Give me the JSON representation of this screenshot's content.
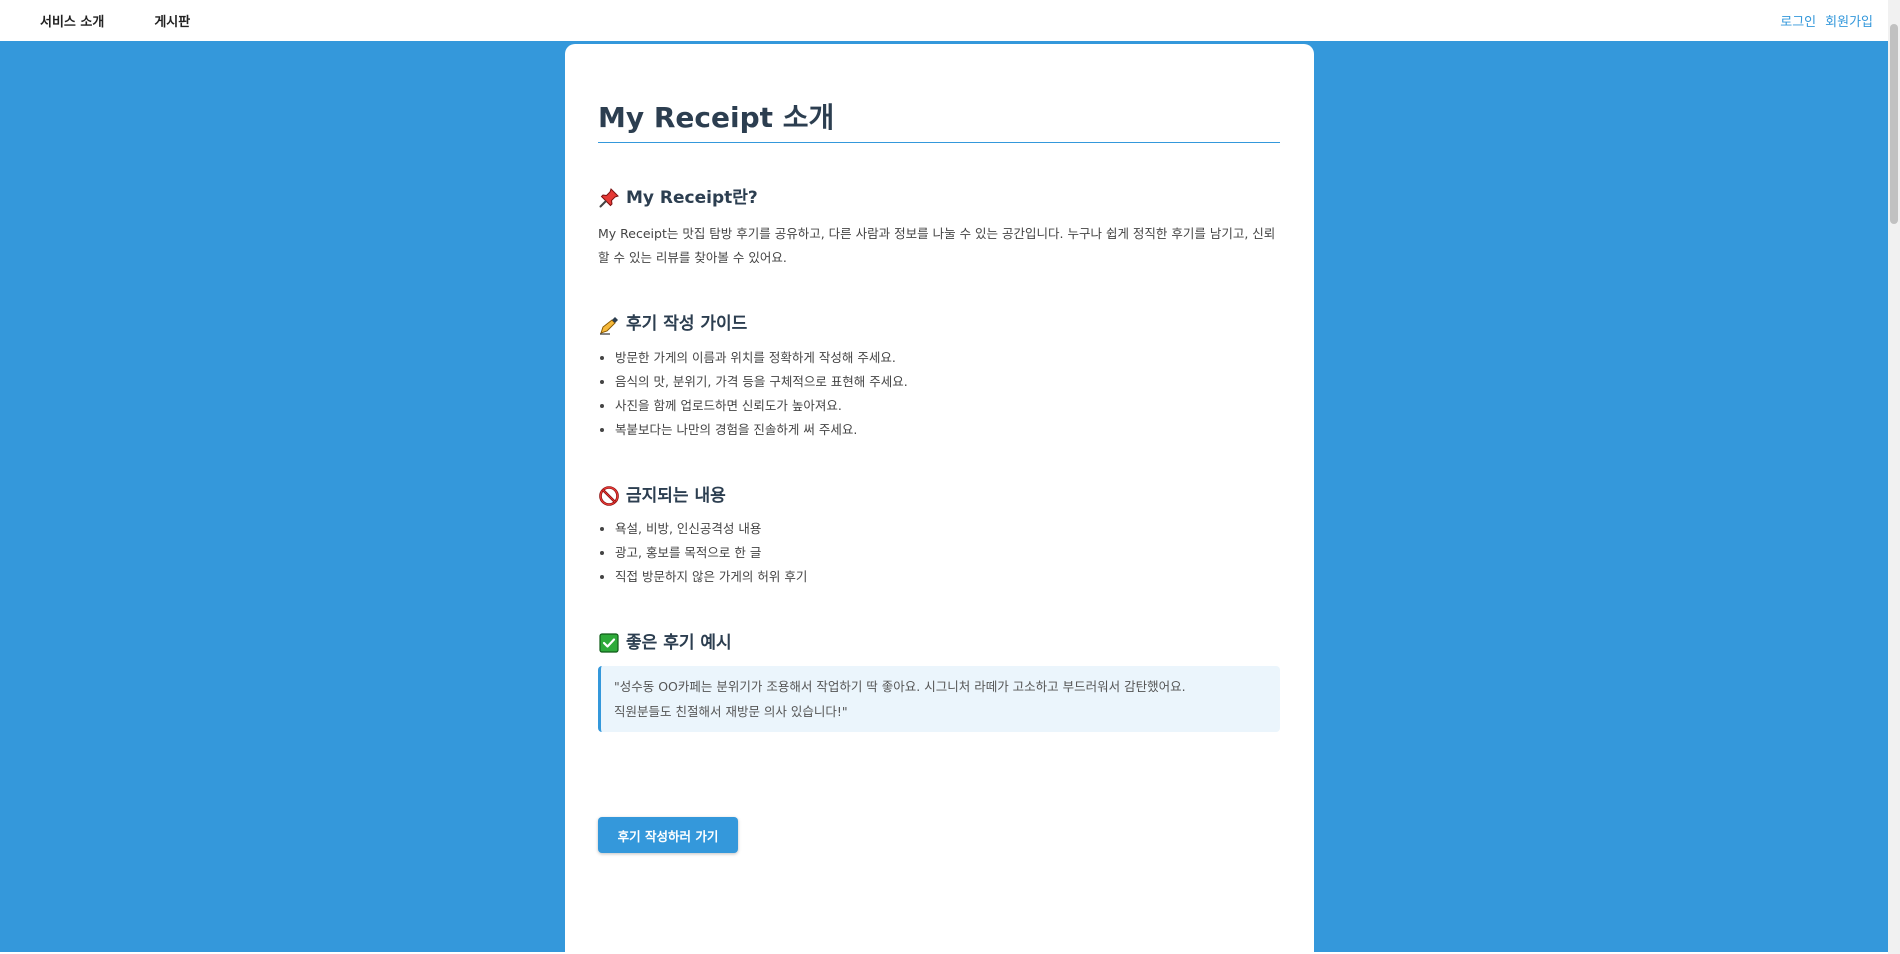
{
  "header": {
    "nav": [
      {
        "label": "서비스 소개"
      },
      {
        "label": "게시판"
      }
    ],
    "login_label": "로그인",
    "signup_label": "회원가입"
  },
  "main": {
    "title": "My Receipt 소개",
    "sections": [
      {
        "icon": "pushpin-icon",
        "heading": "My Receipt란?",
        "paragraph": "My Receipt는 맛집 탐방 후기를 공유하고, 다른 사람과 정보를 나눌 수 있는 공간입니다. 누구나 쉽게 정직한 후기를 남기고, 신뢰할 수 있는 리뷰를 찾아볼 수 있어요."
      },
      {
        "icon": "writing-hand-icon",
        "heading": "후기 작성 가이드",
        "items": [
          "방문한 가게의 이름과 위치를 정확하게 작성해 주세요.",
          "음식의 맛, 분위기, 가격 등을 구체적으로 표현해 주세요.",
          "사진을 함께 업로드하면 신뢰도가 높아져요.",
          "복붙보다는 나만의 경험을 진솔하게 써 주세요."
        ]
      },
      {
        "icon": "prohibited-icon",
        "heading": "금지되는 내용",
        "items": [
          "욕설, 비방, 인신공격성 내용",
          "광고, 홍보를 목적으로 한 글",
          "직접 방문하지 않은 가게의 허위 후기"
        ]
      },
      {
        "icon": "check-mark-icon",
        "heading": "좋은 후기 예시",
        "example_line1": "\"성수동 OO카페는 분위기가 조용해서 작업하기 딱 좋아요. 시그니처 라떼가 고소하고 부드러워서 감탄했어요.",
        "example_line2": "직원분들도 친절해서 재방문 의사 있습니다!\""
      }
    ],
    "cta_label": "후기 작성하러 가기"
  },
  "colors": {
    "accent": "#3498db",
    "heading": "#2c3e50",
    "example_bg": "#ebf5fc"
  }
}
